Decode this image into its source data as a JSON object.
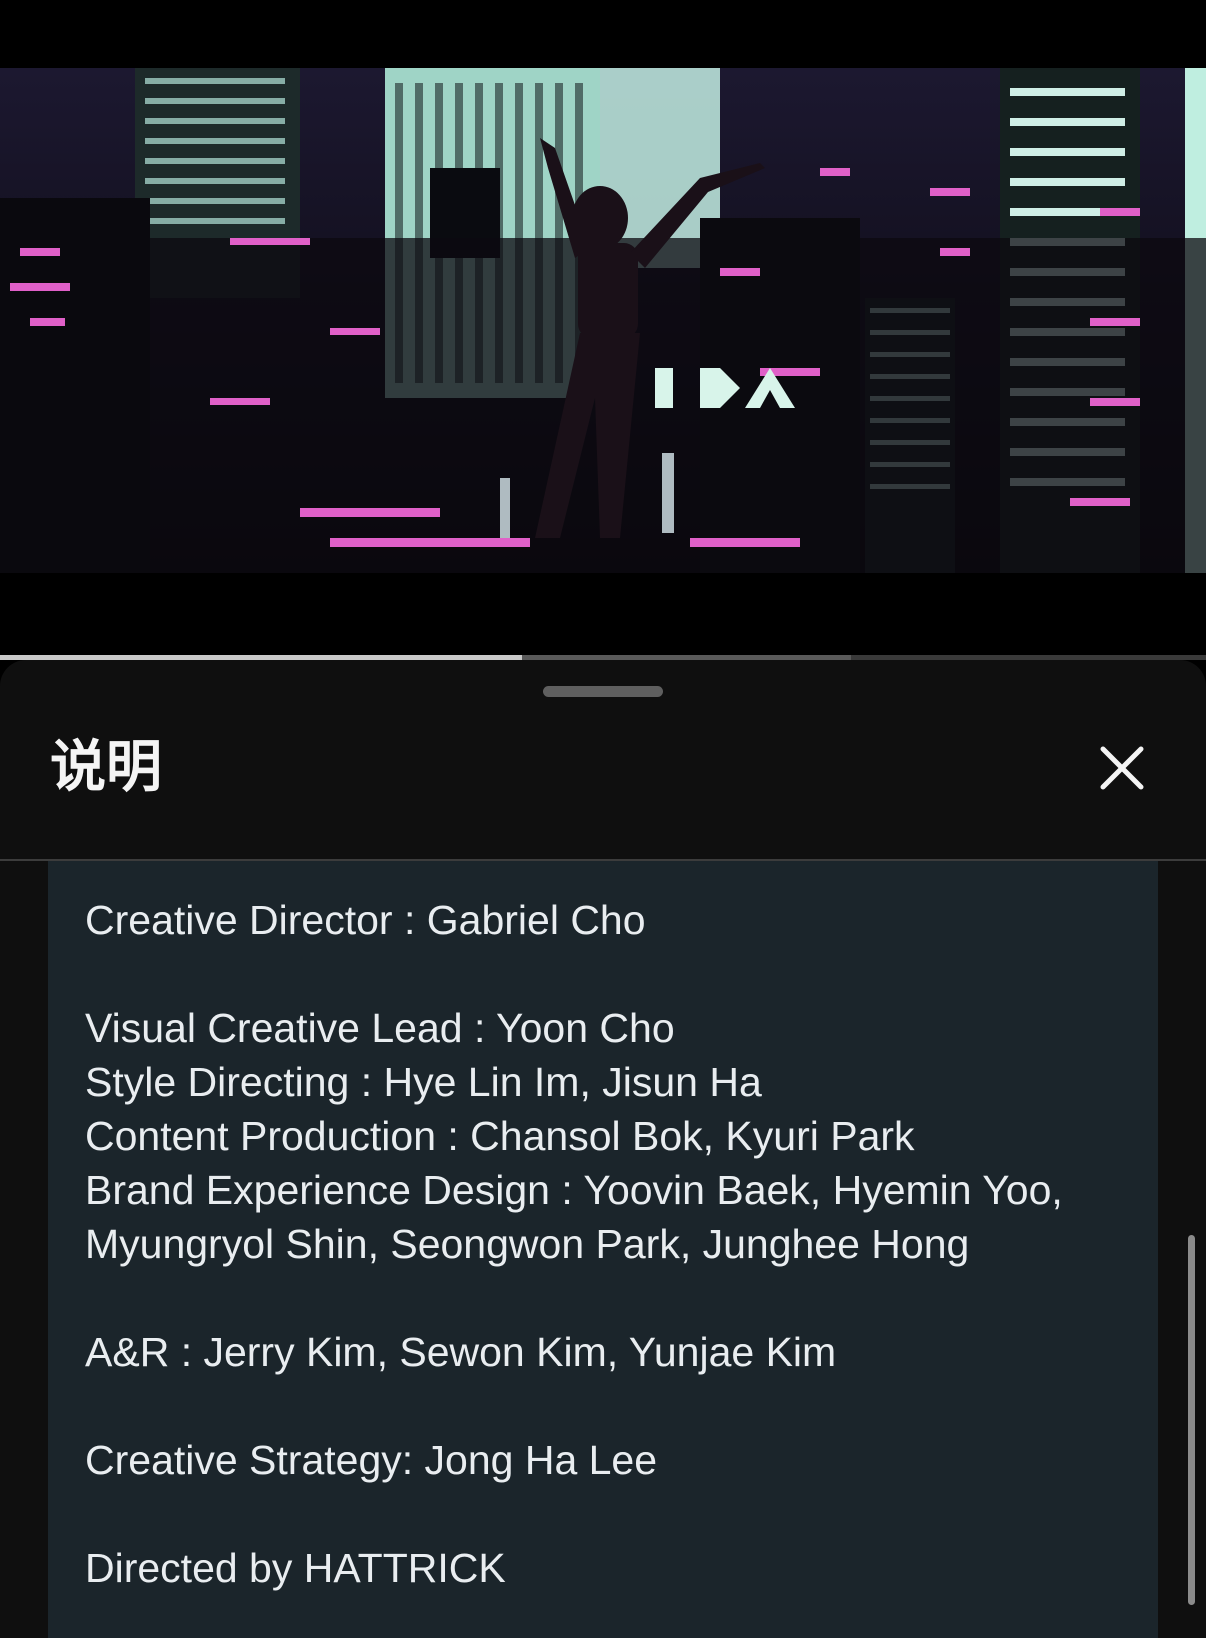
{
  "video": {
    "progress": {
      "played_fraction": 0.433,
      "buffered_fraction": 0.706
    }
  },
  "sheet": {
    "title": "说明",
    "close_icon": "close-icon",
    "credits": {
      "creative_director": "Creative Director : Gabriel Cho",
      "visual_creative_lead": "Visual Creative Lead : Yoon Cho",
      "style_directing": "Style Directing : Hye Lin Im, Jisun Ha",
      "content_production": "Content Production : Chansol Bok, Kyuri Park",
      "brand_experience_1": "Brand Experience Design : Yoovin Baek, Hyemin Yoo,",
      "brand_experience_2": "Myungryol Shin, Seongwon Park, Junghee Hong",
      "a_and_r": "A&R : Jerry Kim, Sewon Kim, Yunjae Kim",
      "creative_strategy": "Creative Strategy: Jong Ha Lee",
      "directed_by": "Directed by HATTRICK"
    }
  },
  "colors": {
    "background": "#000000",
    "sheet": "#0f0f0f",
    "credits_box": "#1b252b",
    "text": "#e9edf0",
    "accent_neon_pink": "#e060c8",
    "accent_neon_mint": "#bfeee0"
  }
}
